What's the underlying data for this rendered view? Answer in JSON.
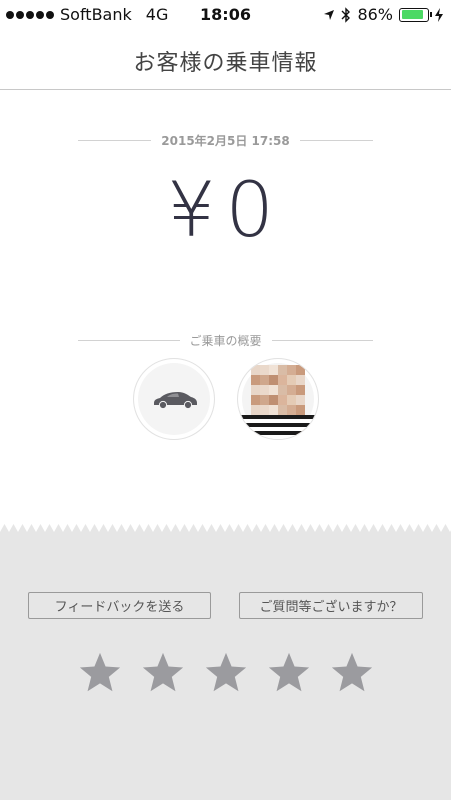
{
  "status_bar": {
    "carrier": "SoftBank",
    "network": "4G",
    "time": "18:06",
    "battery_percent": "86%",
    "battery_level": 0.86
  },
  "header": {
    "title": "お客様の乗車情報"
  },
  "trip": {
    "datetime": "2015年2月5日 17:58",
    "fare": "¥0",
    "summary_label": "ご乗車の概要"
  },
  "actions": {
    "feedback_label": "フィードバックを送る",
    "question_label": "ご質問等ございますか？"
  },
  "rating": {
    "max": 5,
    "value": 0
  },
  "colors": {
    "star": "#9b9b9f",
    "bottom_bg": "#e6e6e6",
    "battery": "#4cd964"
  }
}
